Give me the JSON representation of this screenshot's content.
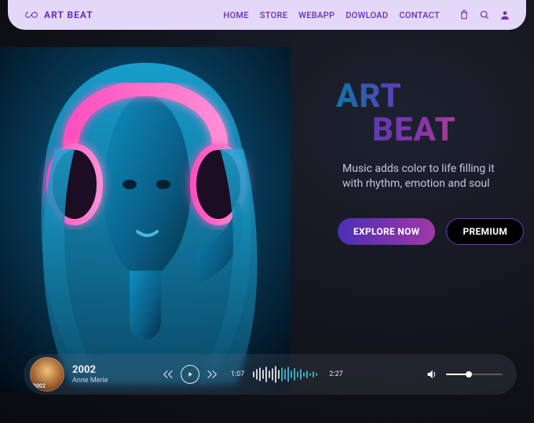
{
  "brand": {
    "name": "ART BEAT"
  },
  "nav": {
    "items": [
      {
        "label": "HOME"
      },
      {
        "label": "STORE"
      },
      {
        "label": "WEBAPP"
      },
      {
        "label": "DOWLOAD"
      },
      {
        "label": "CONTACT"
      }
    ]
  },
  "hero": {
    "title_line1": "ART",
    "title_line2": "BEAT",
    "tagline": "Music adds color to life filling it with rhythm, emotion and soul",
    "cta_primary": "EXPLORE NOW",
    "cta_secondary": "PREMIUM"
  },
  "player": {
    "track_title": "2002",
    "artist": "Anne Merie",
    "cover_year": "2002",
    "elapsed": "1:07",
    "duration": "2:27",
    "volume_percent": 40
  },
  "colors": {
    "accent": "#7a34c7",
    "gradient_start": "#4a2fb5",
    "gradient_end": "#a038a5"
  }
}
